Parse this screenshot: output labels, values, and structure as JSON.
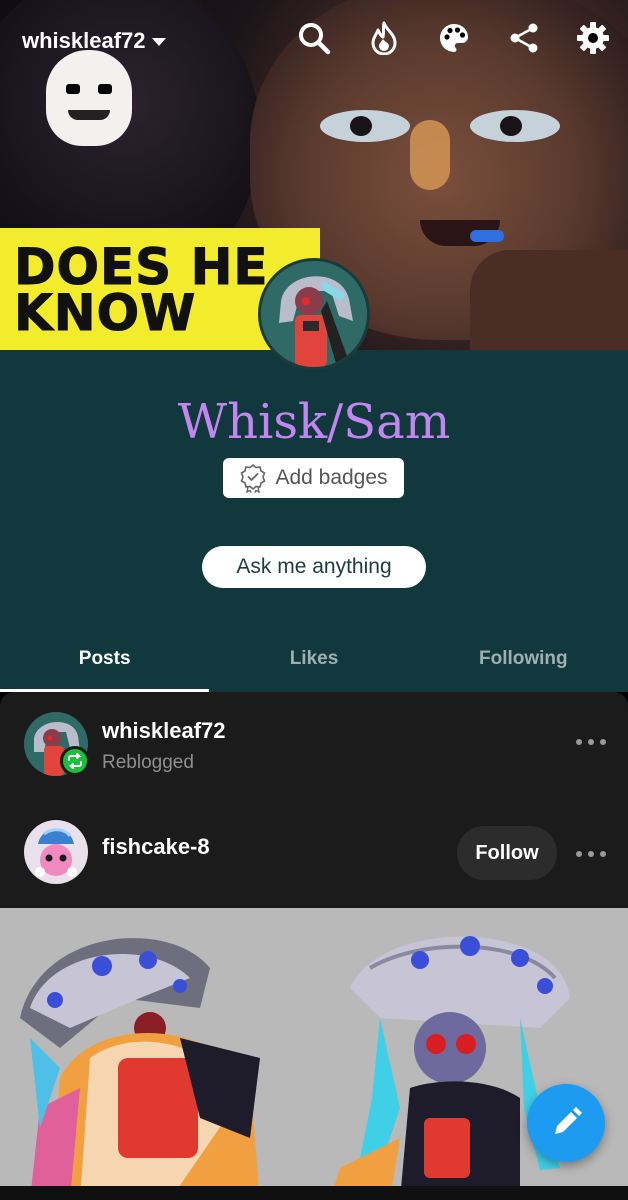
{
  "header": {
    "username": "whiskleaf72",
    "banner_caption": [
      "DOES HE",
      "KNOW"
    ],
    "icons": [
      "search-icon",
      "flame-icon",
      "palette-icon",
      "share-icon",
      "gear-icon"
    ]
  },
  "profile": {
    "title": "Whisk/Sam",
    "badges_label": "Add badges",
    "ask_label": "Ask me anything",
    "title_color": "#c386f0",
    "background_color": "#11393d"
  },
  "tabs": [
    {
      "label": "Posts",
      "active": true
    },
    {
      "label": "Likes",
      "active": false
    },
    {
      "label": "Following",
      "active": false
    }
  ],
  "post": {
    "reblogger": {
      "name": "whiskleaf72",
      "status": "Reblogged"
    },
    "author": {
      "name": "fishcake-8",
      "follow_label": "Follow"
    }
  },
  "colors": {
    "accent_blue": "#1d9bf0",
    "reblog_green": "#1bbf3c"
  }
}
